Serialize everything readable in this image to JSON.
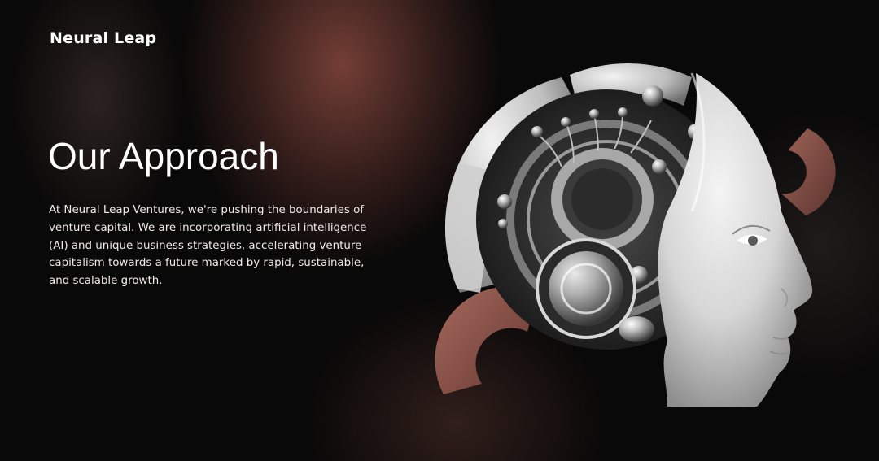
{
  "header": {
    "logo_text": "Neural Leap"
  },
  "main": {
    "heading": "Our Approach",
    "paragraph": "At Neural Leap Ventures, we're pushing the boundaries of venture capital. We are incorporating artificial intelligence (AI) and unique business strategies, accelerating venture capitalism towards a future marked by rapid, sustainable, and scalable growth."
  },
  "hero_image": {
    "subject": "robot-head-with-mechanical-interior"
  },
  "colors": {
    "background": "#0a0909",
    "accent_glow": "#96504a",
    "text": "#ffffff",
    "arc_accent": "#b06a5e"
  }
}
